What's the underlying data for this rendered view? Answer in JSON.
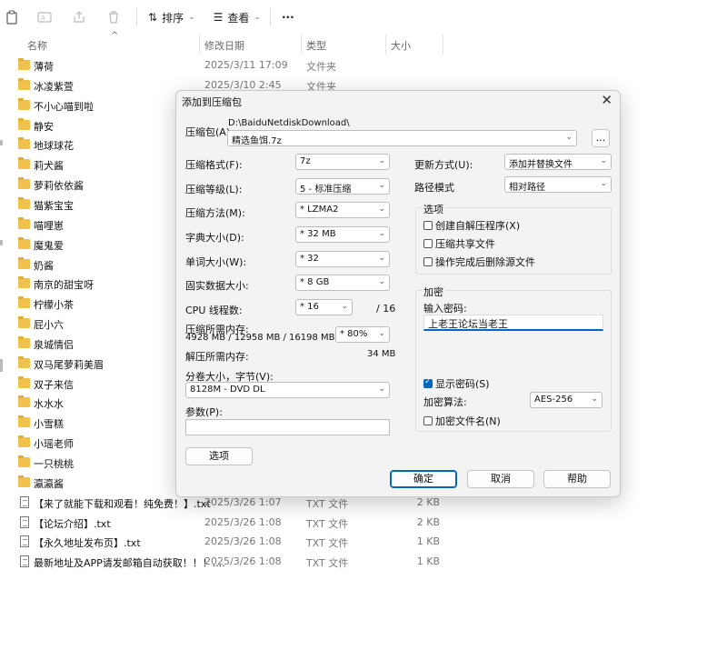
{
  "toolbar": {
    "sort_label": "排序",
    "view_label": "查看",
    "more_label": "···"
  },
  "columns": {
    "name": "名称",
    "date": "修改日期",
    "type": "类型",
    "size": "大小"
  },
  "files": [
    {
      "name": "薄荷",
      "date": "2025/3/11 17:09",
      "type": "文件夹",
      "size": "",
      "kind": "folder"
    },
    {
      "name": "冰凌紫萱",
      "date": "2025/3/10 2:45",
      "type": "文件夹",
      "size": "",
      "kind": "folder"
    },
    {
      "name": "不小心喵到啦",
      "date": "",
      "type": "",
      "size": "",
      "kind": "folder"
    },
    {
      "name": "静安",
      "date": "",
      "type": "",
      "size": "",
      "kind": "folder"
    },
    {
      "name": "地球球花",
      "date": "",
      "type": "",
      "size": "",
      "kind": "folder"
    },
    {
      "name": "莉犬酱",
      "date": "",
      "type": "",
      "size": "",
      "kind": "folder"
    },
    {
      "name": "萝莉依依酱",
      "date": "",
      "type": "",
      "size": "",
      "kind": "folder"
    },
    {
      "name": "猫紫宝宝",
      "date": "",
      "type": "",
      "size": "",
      "kind": "folder"
    },
    {
      "name": "喵哩崽",
      "date": "",
      "type": "",
      "size": "",
      "kind": "folder"
    },
    {
      "name": "魔鬼爱",
      "date": "",
      "type": "",
      "size": "",
      "kind": "folder"
    },
    {
      "name": "奶酱",
      "date": "",
      "type": "",
      "size": "",
      "kind": "folder"
    },
    {
      "name": "南京的甜宝呀",
      "date": "",
      "type": "",
      "size": "",
      "kind": "folder"
    },
    {
      "name": "柠檬小茶",
      "date": "",
      "type": "",
      "size": "",
      "kind": "folder"
    },
    {
      "name": "屁小六",
      "date": "",
      "type": "",
      "size": "",
      "kind": "folder"
    },
    {
      "name": "泉城情侣",
      "date": "",
      "type": "",
      "size": "",
      "kind": "folder"
    },
    {
      "name": "双马尾萝莉美眉",
      "date": "",
      "type": "",
      "size": "",
      "kind": "folder"
    },
    {
      "name": "双子来信",
      "date": "",
      "type": "",
      "size": "",
      "kind": "folder"
    },
    {
      "name": "水水水",
      "date": "",
      "type": "",
      "size": "",
      "kind": "folder"
    },
    {
      "name": "小雪糕",
      "date": "",
      "type": "",
      "size": "",
      "kind": "folder"
    },
    {
      "name": "小瑶老师",
      "date": "",
      "type": "",
      "size": "",
      "kind": "folder"
    },
    {
      "name": "一只桃桃",
      "date": "",
      "type": "",
      "size": "",
      "kind": "folder"
    },
    {
      "name": "瀛瀛酱",
      "date": "",
      "type": "",
      "size": "",
      "kind": "folder"
    },
    {
      "name": "【来了就能下载和观看！纯免费！】.txt",
      "date": "2025/3/26 1:07",
      "type": "TXT 文件",
      "size": "2 KB",
      "kind": "file"
    },
    {
      "name": "【论坛介绍】.txt",
      "date": "2025/3/26 1:08",
      "type": "TXT 文件",
      "size": "2 KB",
      "kind": "file"
    },
    {
      "name": "【永久地址发布页】.txt",
      "date": "2025/3/26 1:08",
      "type": "TXT 文件",
      "size": "1 KB",
      "kind": "file"
    },
    {
      "name": "最新地址及APP请发邮箱自动获取！！！....",
      "date": "2025/3/26 1:08",
      "type": "TXT 文件",
      "size": "1 KB",
      "kind": "file"
    }
  ],
  "dialog": {
    "title": "添加到压缩包",
    "archive_label": "压缩包(A)",
    "archive_path": "D:\\BaiduNetdiskDownload\\",
    "archive_name": "精选鱼饵.7z",
    "browse_label": "...",
    "format_label": "压缩格式(F):",
    "format_value": "7z",
    "level_label": "压缩等级(L):",
    "level_value": "5 - 标准压缩",
    "method_label": "压缩方法(M):",
    "method_value": "* LZMA2",
    "dict_label": "字典大小(D):",
    "dict_value": "* 32 MB",
    "word_label": "单词大小(W):",
    "word_value": "* 32",
    "solid_label": "固实数据大小:",
    "solid_value": "* 8 GB",
    "cpu_label": "CPU 线程数:",
    "cpu_value": "* 16",
    "cpu_total": "/ 16",
    "mem_label": "压缩所需内存:",
    "mem_detail": "4928 MB / 12958 MB / 16198 MB",
    "mem_pct": "* 80%",
    "demem_label": "解压所需内存:",
    "demem_value": "34 MB",
    "split_label": "分卷大小，字节(V):",
    "split_value": "8128M - DVD DL",
    "params_label": "参数(P):",
    "options_button": "选项",
    "update_label": "更新方式(U):",
    "update_value": "添加并替换文件",
    "path_label": "路径模式",
    "path_value": "相对路径",
    "options_group": "选项",
    "opt_sfx": "创建自解压程序(X)",
    "opt_shared": "压缩共享文件",
    "opt_delete": "操作完成后删除源文件",
    "encrypt_group": "加密",
    "pwd_label": "输入密码:",
    "pwd_value": "上老王论坛当老王",
    "show_pwd": "显示密码(S)",
    "enc_method_label": "加密算法:",
    "enc_method_value": "AES-256",
    "enc_names": "加密文件名(N)",
    "ok": "确定",
    "cancel": "取消",
    "help": "帮助"
  }
}
